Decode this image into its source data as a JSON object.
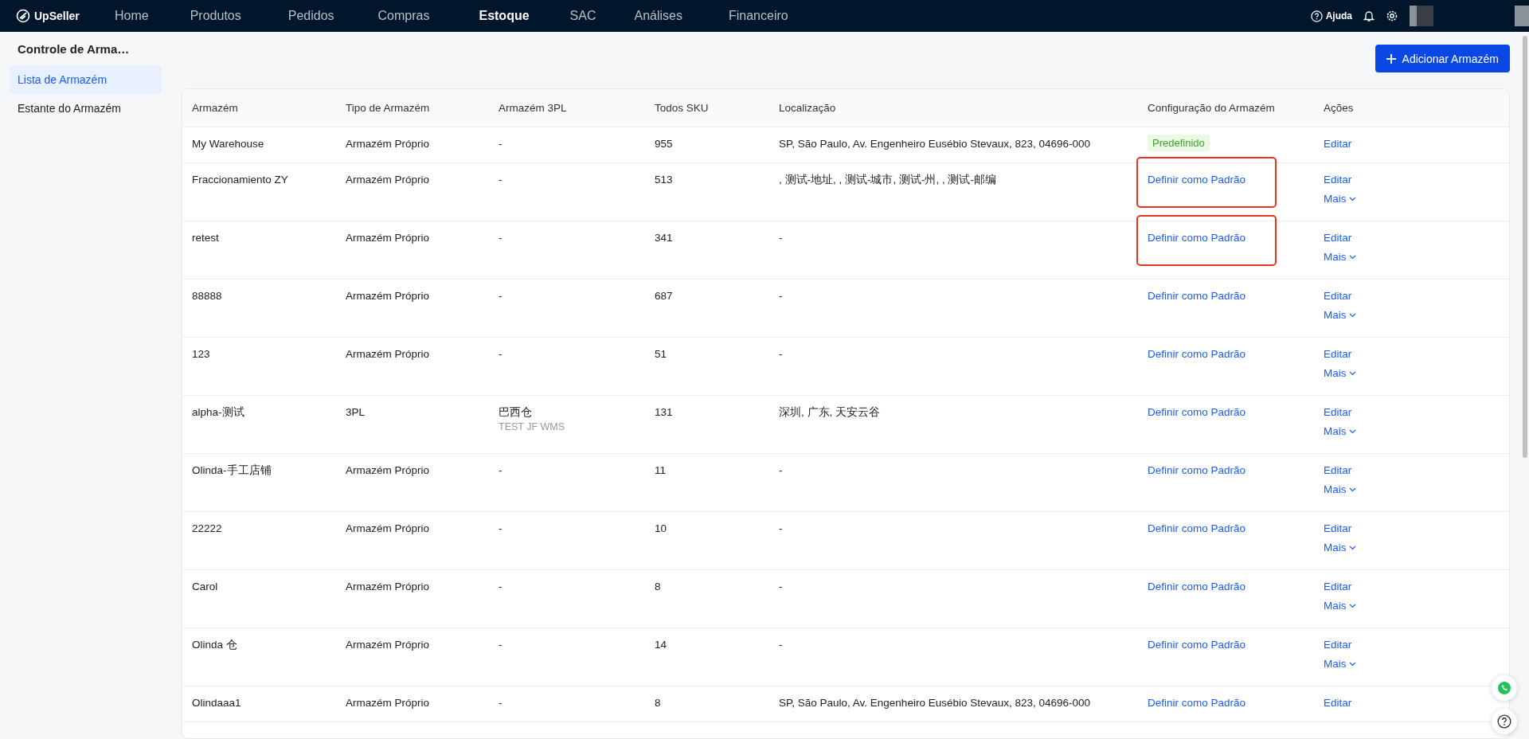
{
  "nav": {
    "brand": "UpSeller",
    "items": [
      {
        "label": "Home",
        "selected": false
      },
      {
        "label": "Produtos",
        "selected": false
      },
      {
        "label": "Pedidos",
        "selected": false
      },
      {
        "label": "Compras",
        "selected": false
      },
      {
        "label": "Estoque",
        "selected": true
      },
      {
        "label": "SAC",
        "selected": false
      },
      {
        "label": "Análises",
        "selected": false
      },
      {
        "label": "Financeiro",
        "selected": false
      }
    ],
    "help": "Ajuda"
  },
  "sidebar": {
    "title": "Controle de Arma…",
    "items": [
      {
        "label": "Lista de Armazém",
        "selected": true
      },
      {
        "label": "Estante do Armazém",
        "selected": false
      }
    ]
  },
  "add_button": "Adicionar Armazém",
  "table": {
    "columns": [
      "Armazém",
      "Tipo de Armazém",
      "Armazém 3PL",
      "Todos SKU",
      "Localização",
      "Configuração do Armazém",
      "Ações"
    ],
    "rows": [
      {
        "name": "My Warehouse",
        "type": "Armazém Próprio",
        "tpl": "-",
        "sku": "955",
        "location": "SP, São Paulo, Av. Engenheiro Eusébio Stevaux, 823, 04696-000",
        "config": {
          "kind": "badge",
          "label": "Predefinido"
        },
        "highlighted": false,
        "actions": [
          "Editar"
        ]
      },
      {
        "name": "Fraccionamiento ZY",
        "type": "Armazém Próprio",
        "tpl": "-",
        "sku": "513",
        "location": ", 测试-地址, , 测试-城市, 测试-州, , 测试-邮编",
        "config": {
          "kind": "link",
          "label": "Definir como Padrão"
        },
        "highlighted": true,
        "actions": [
          "Editar",
          "Mais"
        ]
      },
      {
        "name": "retest",
        "type": "Armazém Próprio",
        "tpl": "-",
        "sku": "341",
        "location": "-",
        "config": {
          "kind": "link",
          "label": "Definir como Padrão"
        },
        "highlighted": true,
        "actions": [
          "Editar",
          "Mais"
        ]
      },
      {
        "name": "88888",
        "type": "Armazém Próprio",
        "tpl": "-",
        "sku": "687",
        "location": "-",
        "config": {
          "kind": "link",
          "label": "Definir como Padrão"
        },
        "highlighted": false,
        "actions": [
          "Editar",
          "Mais"
        ]
      },
      {
        "name": "123",
        "type": "Armazém Próprio",
        "tpl": "-",
        "sku": "51",
        "location": "-",
        "config": {
          "kind": "link",
          "label": "Definir como Padrão"
        },
        "highlighted": false,
        "actions": [
          "Editar",
          "Mais"
        ]
      },
      {
        "name": "alpha-测试",
        "type": "3PL",
        "tpl": "巴西仓",
        "tpl_sub": "TEST JF WMS",
        "sku": "131",
        "location": "深圳, 广东, 天安云谷",
        "config": {
          "kind": "link",
          "label": "Definir como Padrão"
        },
        "highlighted": false,
        "actions": [
          "Editar",
          "Mais"
        ]
      },
      {
        "name": "Olinda-手工店铺",
        "type": "Armazém Próprio",
        "tpl": "-",
        "sku": "11",
        "location": "-",
        "config": {
          "kind": "link",
          "label": "Definir como Padrão"
        },
        "highlighted": false,
        "actions": [
          "Editar",
          "Mais"
        ]
      },
      {
        "name": "22222",
        "type": "Armazém Próprio",
        "tpl": "-",
        "sku": "10",
        "location": "-",
        "config": {
          "kind": "link",
          "label": "Definir como Padrão"
        },
        "highlighted": false,
        "actions": [
          "Editar",
          "Mais"
        ]
      },
      {
        "name": "Carol",
        "type": "Armazém Próprio",
        "tpl": "-",
        "sku": "8",
        "location": "-",
        "config": {
          "kind": "link",
          "label": "Definir como Padrão"
        },
        "highlighted": false,
        "actions": [
          "Editar",
          "Mais"
        ]
      },
      {
        "name": "Olinda 仓",
        "type": "Armazém Próprio",
        "tpl": "-",
        "sku": "14",
        "location": "-",
        "config": {
          "kind": "link",
          "label": "Definir como Padrão"
        },
        "highlighted": false,
        "actions": [
          "Editar",
          "Mais"
        ]
      },
      {
        "name": "Olindaaa1",
        "type": "Armazém Próprio",
        "tpl": "-",
        "sku": "8",
        "location": "SP, São Paulo, Av. Engenheiro Eusébio Stevaux, 823, 04696-000",
        "config": {
          "kind": "link",
          "label": "Definir como Padrão"
        },
        "highlighted": false,
        "actions": [
          "Editar"
        ]
      }
    ]
  }
}
